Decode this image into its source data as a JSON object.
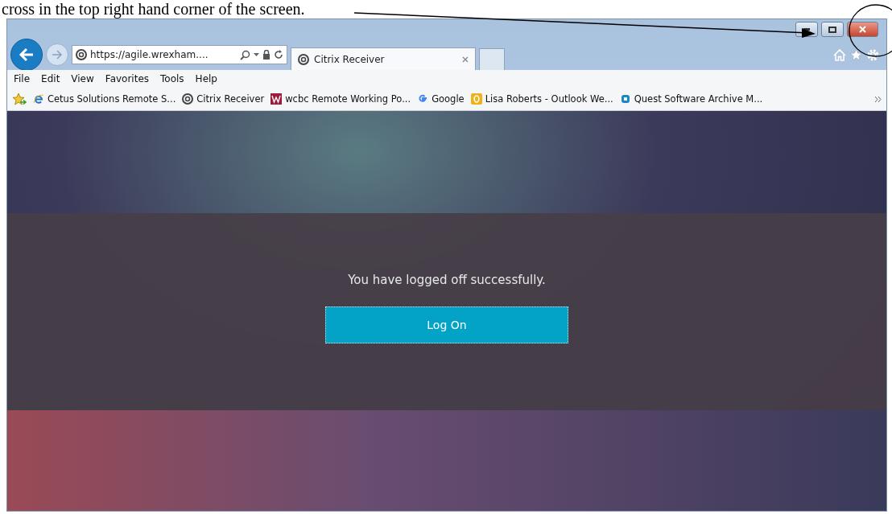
{
  "caption": "cross in the top right hand corner of the screen.",
  "browser": {
    "address": "https://agile.wrexham....",
    "tabs": [
      {
        "title": "Citrix Receiver",
        "selected": true
      }
    ],
    "menu": [
      "File",
      "Edit",
      "View",
      "Favorites",
      "Tools",
      "Help"
    ],
    "favorites": [
      {
        "kind": "ie",
        "label": "Cetus Solutions Remote S..."
      },
      {
        "kind": "citrix",
        "label": "Citrix Receiver"
      },
      {
        "kind": "wcbc",
        "label": "wcbc Remote Working Po..."
      },
      {
        "kind": "google",
        "label": "Google"
      },
      {
        "kind": "outlook",
        "label": "Lisa Roberts - Outlook We..."
      },
      {
        "kind": "quest",
        "label": "Quest Software Archive M..."
      }
    ]
  },
  "page": {
    "message": "You have logged off successfully.",
    "button": "Log On"
  }
}
